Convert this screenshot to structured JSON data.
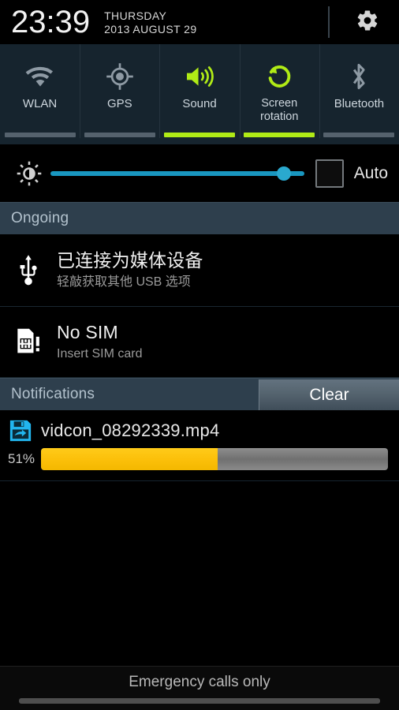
{
  "header": {
    "clock": "23:39",
    "day_of_week": "THURSDAY",
    "date": "2013 AUGUST 29",
    "settings_icon": "gear-icon"
  },
  "quick_toggles": [
    {
      "label": "WLAN",
      "icon": "wifi-icon",
      "active": false
    },
    {
      "label": "GPS",
      "icon": "gps-icon",
      "active": false
    },
    {
      "label": "Sound",
      "icon": "sound-icon",
      "active": true
    },
    {
      "label": "Screen rotation",
      "label_line1": "Screen",
      "label_line2": "rotation",
      "icon": "screen-rotation-icon",
      "active": true
    },
    {
      "label": "Bluetooth",
      "icon": "bluetooth-icon",
      "active": false
    }
  ],
  "brightness": {
    "icon": "brightness-icon",
    "value_percent": 92,
    "auto_label": "Auto",
    "auto_checked": false
  },
  "ongoing": {
    "section_title": "Ongoing",
    "items": [
      {
        "icon": "usb-icon",
        "title": "已连接为媒体设备",
        "subtitle": "轻敲获取其他 USB 选项"
      },
      {
        "icon": "sim-card-icon",
        "title": "No SIM",
        "subtitle": "Insert SIM card"
      }
    ]
  },
  "notifications": {
    "section_title": "Notifications",
    "clear_label": "Clear",
    "items": [
      {
        "icon": "download-save-icon",
        "title": "vidcon_08292339.mp4",
        "progress_label": "51%",
        "progress_percent": 51
      }
    ]
  },
  "footer": {
    "status_text": "Emergency calls only"
  },
  "colors": {
    "accent_green": "#b0eb16",
    "slider_blue": "#1997c0",
    "progress_amber": "#fcc00a",
    "download_icon_cyan": "#22b6ef",
    "section_header_bg": "#2e3f4d",
    "toggle_bg": "#16242e"
  }
}
